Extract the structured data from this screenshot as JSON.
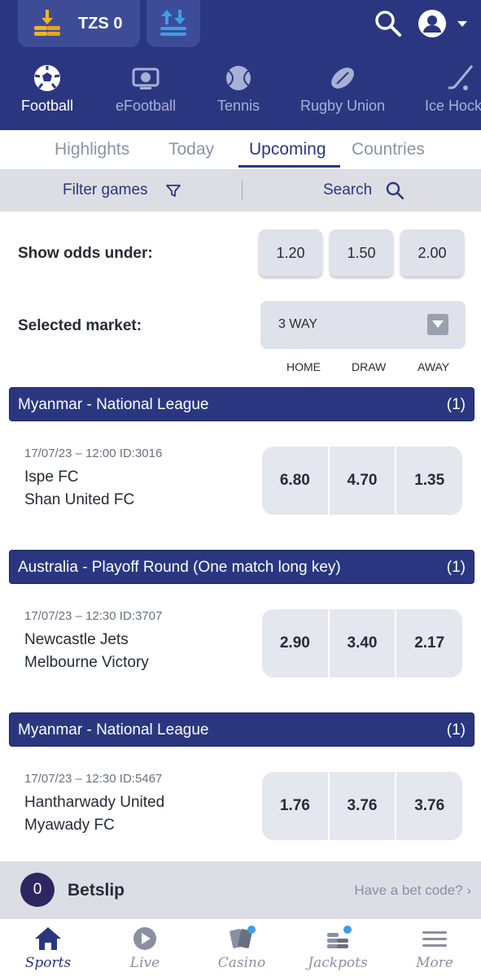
{
  "header": {
    "balance": "TZS 0",
    "colors": {
      "brand": "#2a3780",
      "coin": "#f0b429",
      "accent_blue": "#3aa0e8"
    },
    "icons": [
      "coin-deposit-icon",
      "transfer-icon",
      "search-icon",
      "user-account-icon",
      "chevron-down-icon"
    ]
  },
  "sports": [
    {
      "label": "Football",
      "icon": "football-icon",
      "active": true
    },
    {
      "label": "eFootball",
      "icon": "efootball-icon",
      "active": false
    },
    {
      "label": "Tennis",
      "icon": "tennis-ball-icon",
      "active": false
    },
    {
      "label": "Rugby Union",
      "icon": "rugby-ball-icon",
      "active": false
    },
    {
      "label": "Ice Hock",
      "icon": "ice-hockey-stick-icon",
      "active": false
    }
  ],
  "tabs": [
    {
      "label": "Highlights",
      "active": false
    },
    {
      "label": "Today",
      "active": false
    },
    {
      "label": "Upcoming",
      "active": true
    },
    {
      "label": "Countries",
      "active": false
    }
  ],
  "filter": {
    "filter_label": "Filter games",
    "search_label": "Search"
  },
  "odds_under": {
    "label": "Show odds under:",
    "options": [
      "1.20",
      "1.50",
      "2.00"
    ]
  },
  "market": {
    "label": "Selected market:",
    "value": "3 WAY",
    "columns": [
      "HOME",
      "DRAW",
      "AWAY"
    ]
  },
  "leagues": [
    {
      "name": "Myanmar - National League",
      "count": "(1)",
      "match": {
        "meta": "17/07/23 – 12:00   ID:3016",
        "home": "Ispe FC",
        "away": "Shan United FC",
        "odds": [
          "6.80",
          "4.70",
          "1.35"
        ]
      }
    },
    {
      "name": "Australia - Playoff Round (One match long key)",
      "count": "(1)",
      "match": {
        "meta": "17/07/23 – 12:30   ID:3707",
        "home": "Newcastle Jets",
        "away": "Melbourne Victory",
        "odds": [
          "2.90",
          "3.40",
          "2.17"
        ]
      }
    },
    {
      "name": "Myanmar - National League",
      "count": "(1)",
      "match": {
        "meta": "17/07/23 – 12:30   ID:5467",
        "home": "Hantharwady United",
        "away": "Myawady FC",
        "odds": [
          "1.76",
          "3.76",
          "3.76"
        ]
      }
    }
  ],
  "betslip": {
    "count": "0",
    "label": "Betslip",
    "code_link": "Have a bet code? ›"
  },
  "bottom_nav": [
    {
      "label": "Sports",
      "icon": "home-icon",
      "active": true
    },
    {
      "label": "Live",
      "icon": "play-icon",
      "active": false
    },
    {
      "label": "Casino",
      "icon": "cards-icon",
      "active": false
    },
    {
      "label": "Jackpots",
      "icon": "coin-stack-icon",
      "active": false
    },
    {
      "label": "More",
      "icon": "menu-icon",
      "active": false
    }
  ]
}
